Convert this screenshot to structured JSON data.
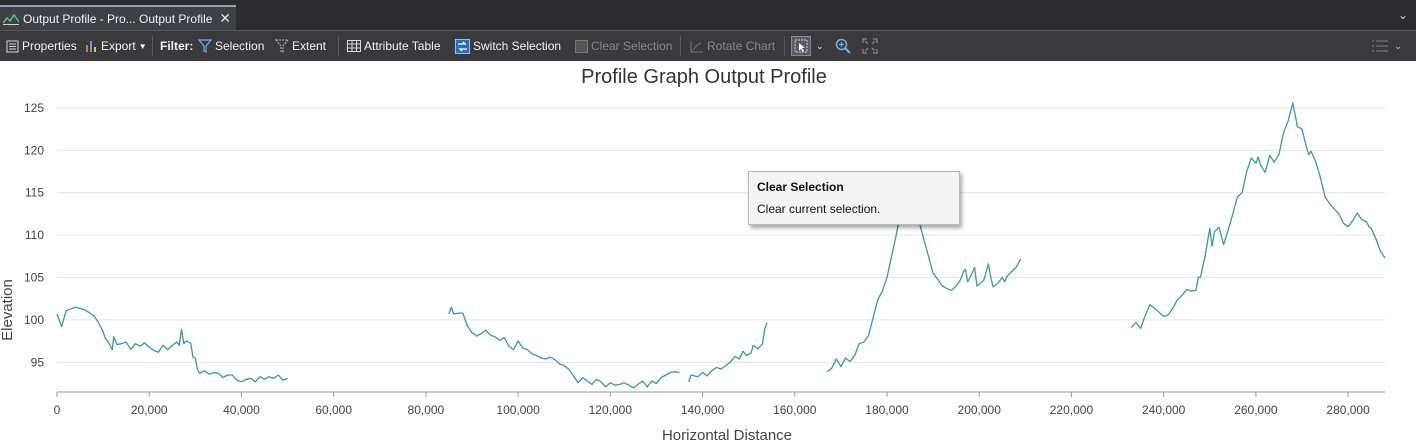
{
  "tab": {
    "title": "Output Profile - Pro... Output Profile",
    "close": "✕"
  },
  "toolbar": {
    "properties": "Properties",
    "export": "Export",
    "filter_label": "Filter:",
    "selection": "Selection",
    "extent": "Extent",
    "attribute_table": "Attribute Table",
    "switch_selection": "Switch Selection",
    "clear_selection": "Clear Selection",
    "rotate_chart": "Rotate Chart"
  },
  "tooltip": {
    "title": "Clear Selection",
    "body": "Clear current selection."
  },
  "colors": {
    "series": "#3a9a9a",
    "toolbar_bg": "#3a3a3d",
    "tab_bg": "#2d2d30"
  },
  "chart_data": {
    "type": "line",
    "title": "Profile Graph Output Profile",
    "xlabel": "Horizontal Distance",
    "ylabel": "Elevation",
    "xlim": [
      0,
      288000
    ],
    "ylim": [
      91.5,
      127
    ],
    "xticks": [
      0,
      20000,
      40000,
      60000,
      80000,
      100000,
      120000,
      140000,
      160000,
      180000,
      200000,
      220000,
      240000,
      260000,
      280000
    ],
    "xtick_labels": [
      "0",
      "20,000",
      "40,000",
      "60,000",
      "80,000",
      "100,000",
      "120,000",
      "140,000",
      "160,000",
      "180,000",
      "200,000",
      "220,000",
      "240,000",
      "260,000",
      "280,000"
    ],
    "yticks": [
      95,
      100,
      105,
      110,
      115,
      120,
      125
    ],
    "ytick_labels": [
      "95",
      "100",
      "105",
      "110",
      "115",
      "120",
      "125"
    ],
    "grid": "horizontal",
    "segments": [
      [
        [
          0,
          100.7
        ],
        [
          1000,
          99.2
        ],
        [
          2000,
          101.1
        ],
        [
          4000,
          101.5
        ],
        [
          6000,
          101.2
        ],
        [
          8000,
          100.5
        ],
        [
          9000,
          99.7
        ],
        [
          10000,
          98.6
        ],
        [
          10500,
          97.8
        ],
        [
          11000,
          97.5
        ],
        [
          12000,
          96.5
        ],
        [
          12300,
          98
        ],
        [
          13000,
          97.1
        ],
        [
          14000,
          97.2
        ],
        [
          15000,
          97.4
        ],
        [
          16000,
          96.5
        ],
        [
          17000,
          97.2
        ],
        [
          18000,
          96.9
        ],
        [
          19000,
          97.3
        ],
        [
          20000,
          96.8
        ],
        [
          21000,
          96.4
        ],
        [
          22000,
          96.2
        ],
        [
          23000,
          97.0
        ],
        [
          24000,
          96.5
        ],
        [
          25000,
          97.0
        ],
        [
          26000,
          97.4
        ],
        [
          26500,
          97.0
        ],
        [
          27000,
          98.9
        ],
        [
          27500,
          97.2
        ],
        [
          28000,
          97.5
        ],
        [
          29000,
          97.3
        ],
        [
          29500,
          95.6
        ],
        [
          30000,
          95.5
        ],
        [
          30500,
          94.1
        ],
        [
          31000,
          93.7
        ],
        [
          32000,
          94.0
        ],
        [
          33000,
          93.6
        ],
        [
          34000,
          93.8
        ],
        [
          35000,
          93.7
        ],
        [
          36000,
          93.2
        ],
        [
          37000,
          93.5
        ],
        [
          38000,
          93.5
        ],
        [
          39000,
          92.9
        ],
        [
          40000,
          92.7
        ],
        [
          41000,
          93.0
        ],
        [
          42000,
          93.1
        ],
        [
          43000,
          92.7
        ],
        [
          44000,
          93.3
        ],
        [
          45000,
          93.0
        ],
        [
          46000,
          93.3
        ],
        [
          47000,
          93.1
        ],
        [
          48000,
          93.5
        ],
        [
          49000,
          92.9
        ],
        [
          50000,
          93.1
        ]
      ],
      [
        [
          85000,
          100.7
        ],
        [
          85500,
          101.5
        ],
        [
          86000,
          100.7
        ],
        [
          87000,
          100.8
        ],
        [
          88000,
          100.8
        ],
        [
          89000,
          99.3
        ],
        [
          90000,
          98.5
        ],
        [
          91000,
          98.1
        ],
        [
          92000,
          98.4
        ],
        [
          93000,
          98.8
        ],
        [
          94000,
          98.2
        ],
        [
          95000,
          98.0
        ],
        [
          96000,
          97.6
        ],
        [
          97000,
          97.9
        ],
        [
          98000,
          96.9
        ],
        [
          99000,
          96.5
        ],
        [
          100000,
          97.5
        ],
        [
          101000,
          96.7
        ],
        [
          102000,
          96.5
        ],
        [
          103000,
          96.0
        ],
        [
          104000,
          95.8
        ],
        [
          105000,
          95.5
        ],
        [
          106000,
          95.4
        ],
        [
          107000,
          95.6
        ],
        [
          108000,
          95.3
        ],
        [
          109000,
          94.8
        ],
        [
          110000,
          94.6
        ],
        [
          111000,
          94.2
        ],
        [
          112000,
          93.4
        ],
        [
          113000,
          92.6
        ],
        [
          114000,
          93.2
        ],
        [
          115000,
          92.8
        ],
        [
          116000,
          92.4
        ],
        [
          117000,
          93.0
        ],
        [
          118000,
          92.7
        ],
        [
          119000,
          92.1
        ],
        [
          120000,
          92.6
        ],
        [
          121000,
          92.3
        ],
        [
          122000,
          92.4
        ],
        [
          123000,
          92.6
        ],
        [
          124000,
          92.3
        ],
        [
          125000,
          92.0
        ],
        [
          126000,
          92.4
        ],
        [
          127000,
          92.8
        ],
        [
          128000,
          92.1
        ],
        [
          129000,
          92.8
        ],
        [
          130000,
          92.5
        ],
        [
          131000,
          93.2
        ],
        [
          132000,
          93.5
        ],
        [
          133000,
          93.8
        ],
        [
          134000,
          93.9
        ],
        [
          135000,
          93.8
        ]
      ],
      [
        [
          137000,
          92.7
        ],
        [
          137500,
          93.5
        ],
        [
          139000,
          93.3
        ],
        [
          140000,
          93.8
        ],
        [
          141000,
          93.4
        ],
        [
          142000,
          94.0
        ],
        [
          143000,
          94.4
        ],
        [
          144000,
          94.2
        ],
        [
          145000,
          94.6
        ],
        [
          146000,
          95.0
        ],
        [
          147000,
          95.7
        ],
        [
          148000,
          95.4
        ],
        [
          148800,
          96.3
        ],
        [
          149500,
          95.8
        ],
        [
          150500,
          96.1
        ],
        [
          151000,
          97.0
        ],
        [
          152000,
          96.6
        ],
        [
          153000,
          97.2
        ],
        [
          153500,
          99.0
        ],
        [
          154000,
          99.7
        ]
      ],
      [
        [
          167000,
          93.9
        ],
        [
          168000,
          94.3
        ],
        [
          169000,
          95.4
        ],
        [
          170000,
          94.5
        ],
        [
          171000,
          95.5
        ],
        [
          172000,
          95.1
        ],
        [
          173000,
          95.8
        ],
        [
          174000,
          97.2
        ],
        [
          175000,
          97.4
        ],
        [
          176000,
          98.2
        ],
        [
          177000,
          100.3
        ],
        [
          178000,
          102.4
        ],
        [
          179000,
          103.4
        ],
        [
          180000,
          105.0
        ],
        [
          181000,
          107.5
        ],
        [
          182000,
          110.0
        ],
        [
          183000,
          112.8
        ],
        [
          184000,
          115.0
        ],
        [
          184500,
          116.0
        ],
        [
          185000,
          115.0
        ],
        [
          186000,
          114.0
        ],
        [
          187000,
          111.5
        ],
        [
          188000,
          109.5
        ],
        [
          189000,
          107.5
        ],
        [
          190000,
          105.5
        ],
        [
          191000,
          104.8
        ],
        [
          192000,
          104.0
        ],
        [
          193000,
          103.7
        ],
        [
          194000,
          103.5
        ],
        [
          195000,
          104.0
        ],
        [
          196000,
          104.8
        ],
        [
          196500,
          105.6
        ],
        [
          197000,
          106.0
        ],
        [
          197500,
          104.5
        ],
        [
          198000,
          105.0
        ],
        [
          199000,
          106.2
        ],
        [
          199500,
          104.0
        ],
        [
          200000,
          104.2
        ],
        [
          201000,
          104.7
        ],
        [
          202000,
          106.6
        ],
        [
          202500,
          105.0
        ],
        [
          203000,
          103.9
        ],
        [
          204000,
          104.3
        ],
        [
          205000,
          105.0
        ],
        [
          205500,
          104.5
        ],
        [
          206000,
          105.1
        ],
        [
          207000,
          105.7
        ],
        [
          208000,
          106.2
        ],
        [
          209000,
          107.2
        ]
      ]
    ],
    "segment5": [
      [
        233000,
        99.1
      ],
      [
        234000,
        99.7
      ],
      [
        235000,
        99.0
      ],
      [
        236000,
        100.5
      ],
      [
        237000,
        101.8
      ],
      [
        238000,
        101.4
      ],
      [
        239000,
        100.9
      ],
      [
        240000,
        100.4
      ],
      [
        241000,
        100.6
      ],
      [
        242000,
        101.4
      ],
      [
        243000,
        102.4
      ],
      [
        244000,
        102.9
      ],
      [
        245000,
        103.6
      ],
      [
        246000,
        103.4
      ],
      [
        247000,
        103.5
      ],
      [
        247500,
        105.0
      ],
      [
        248000,
        105.1
      ],
      [
        249000,
        107.6
      ],
      [
        250000,
        110.8
      ],
      [
        250500,
        108.7
      ],
      [
        251000,
        110.4
      ],
      [
        252000,
        110.9
      ],
      [
        253000,
        108.9
      ],
      [
        254000,
        110.6
      ],
      [
        255000,
        112.5
      ],
      [
        256000,
        114.5
      ],
      [
        257000,
        115.0
      ],
      [
        258000,
        117.5
      ],
      [
        259000,
        119.1
      ],
      [
        260000,
        118.5
      ],
      [
        260500,
        119.2
      ],
      [
        261000,
        118.3
      ],
      [
        262000,
        117.4
      ],
      [
        263000,
        119.4
      ],
      [
        264000,
        118.6
      ],
      [
        265000,
        119.5
      ],
      [
        266000,
        122.1
      ],
      [
        267000,
        123.5
      ],
      [
        268000,
        125.6
      ],
      [
        269000,
        122.8
      ],
      [
        270000,
        122.5
      ],
      [
        271000,
        120.3
      ],
      [
        271500,
        119.5
      ],
      [
        272000,
        119.9
      ],
      [
        273000,
        118.6
      ],
      [
        274000,
        116.8
      ],
      [
        275000,
        114.5
      ],
      [
        276000,
        113.7
      ],
      [
        277000,
        113.1
      ],
      [
        278000,
        112.5
      ],
      [
        279000,
        111.4
      ],
      [
        280000,
        111.0
      ],
      [
        281000,
        111.7
      ],
      [
        282000,
        112.6
      ],
      [
        283000,
        111.8
      ],
      [
        284000,
        111.6
      ],
      [
        284500,
        111.0
      ],
      [
        285000,
        110.8
      ],
      [
        286000,
        109.6
      ],
      [
        287000,
        108.1
      ],
      [
        288000,
        107.3
      ]
    ]
  }
}
